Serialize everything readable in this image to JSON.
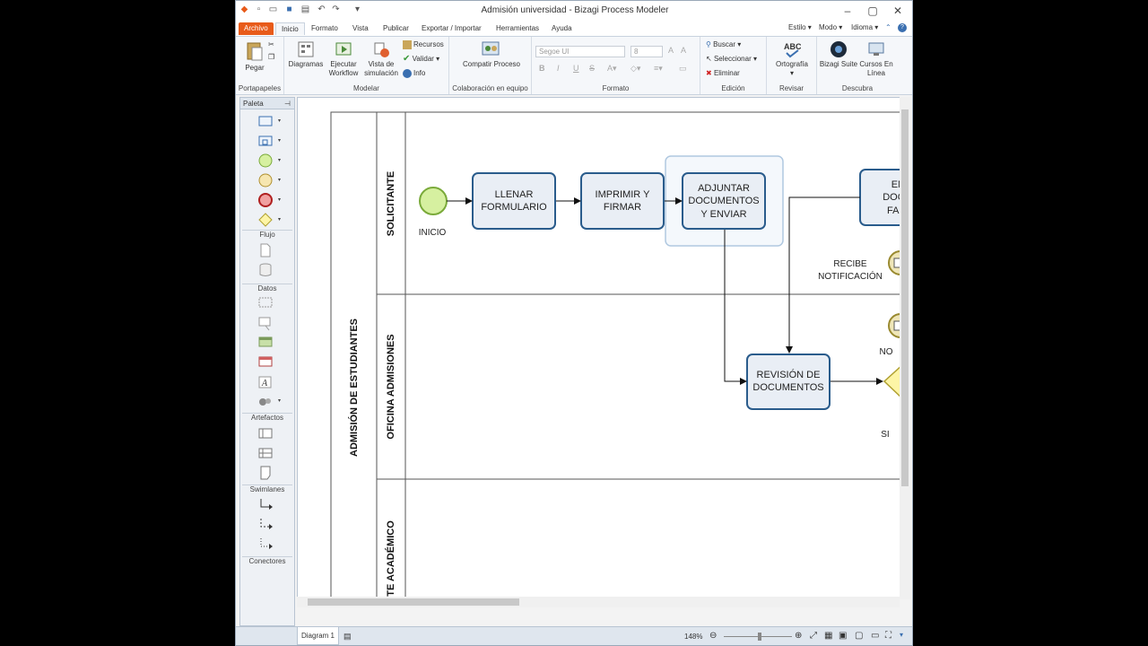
{
  "window": {
    "title": "Admisión universidad - Bizagi Process Modeler"
  },
  "menu": {
    "tabs": [
      "Archivo",
      "Inicio",
      "Formato",
      "Vista",
      "Publicar",
      "Exportar / Importar",
      "Herramientas",
      "Ayuda"
    ],
    "right": [
      "Estilo",
      "Modo",
      "Idioma"
    ]
  },
  "ribbon": {
    "clipboard": {
      "paste": "Pegar",
      "group": "Portapapeles"
    },
    "model": {
      "diagrams": "Diagramas",
      "run": "Ejecutar Workflow",
      "sim": "Vista de simulación",
      "resources": "Recursos",
      "validate": "Validar",
      "info": "Info",
      "group": "Modelar"
    },
    "collab": {
      "share": "Compatir Proceso",
      "group": "Colaboración en equipo"
    },
    "format": {
      "font": "Segoe UI",
      "size": "8",
      "group": "Formato"
    },
    "edit": {
      "search": "Buscar",
      "select": "Seleccionar",
      "delete": "Eliminar",
      "group": "Edición"
    },
    "review": {
      "spell": "Ortografía",
      "group": "Revisar"
    },
    "discover": {
      "suite": "Bizagi Suite",
      "courses": "Cursos En Línea",
      "group": "Descubra"
    }
  },
  "palette": {
    "title": "Paleta",
    "sections": [
      "Flujo",
      "Datos",
      "Artefactos",
      "Swimlanes",
      "Conectores"
    ]
  },
  "diagram": {
    "pool": "ADMISIÓN DE ESTUDIANTES",
    "lanes": [
      "SOLICITANTE",
      "OFICINA ADMISIONES",
      "ITE ACADÉMICO"
    ],
    "start_label": "INICIO",
    "tasks": {
      "t1": [
        "LLENAR",
        "FORMULARIO"
      ],
      "t2": [
        "IMPRIMIR Y",
        "FIRMAR"
      ],
      "t3": [
        "ADJUNTAR",
        "DOCUMENTOS",
        "Y ENVIAR"
      ],
      "t4": [
        "ENV",
        "DOCUM",
        "FALTA"
      ],
      "t5": [
        "REVISIÓN DE",
        "DOCUMENTOS"
      ]
    },
    "event_label": [
      "RECIBE",
      "NOTIFICACIÓN"
    ],
    "no_label": "NO",
    "si_label": "SI"
  },
  "status": {
    "diagram_tab": "Diagram 1",
    "zoom": "148%"
  },
  "colors": {
    "archivo": "#e85b1a",
    "task_stroke": "#2a5c8c",
    "start_fill": "#d6f0a0",
    "gateway_fill": "#fdf5a6"
  }
}
